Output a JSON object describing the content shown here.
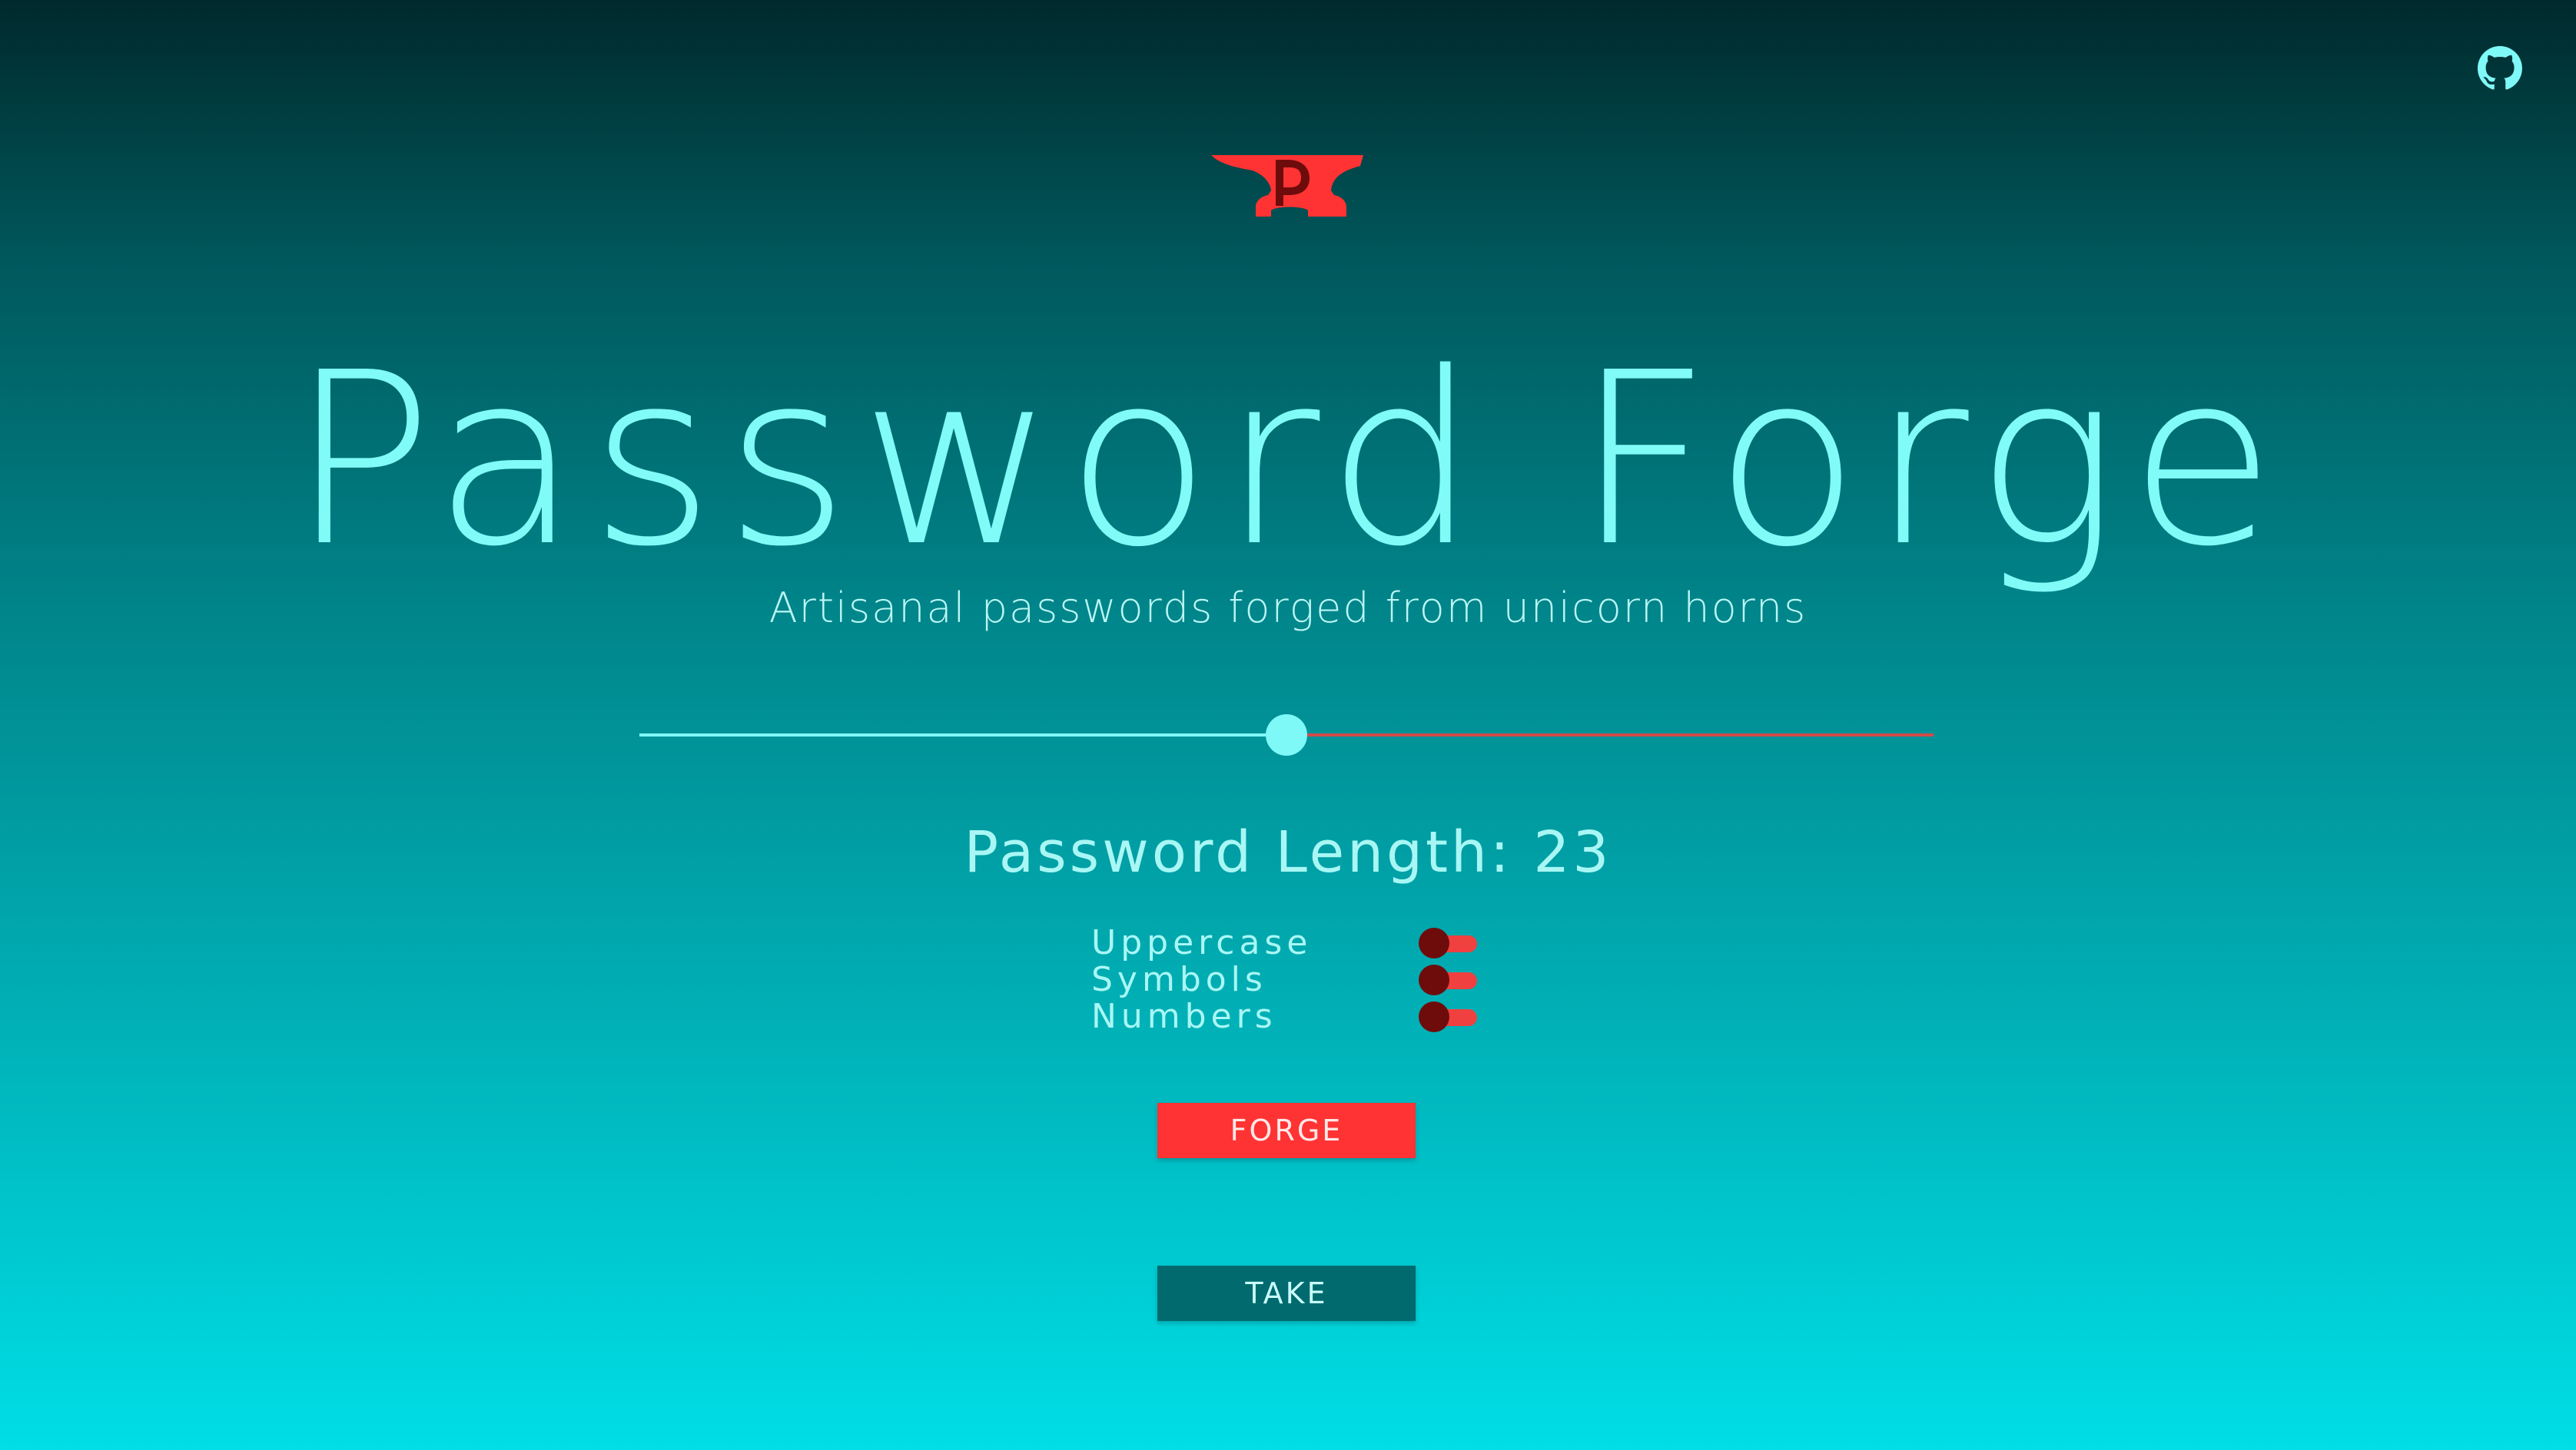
{
  "app": {
    "title": "Password Forge",
    "subtitle": "Artisanal passwords forged from unicorn horns"
  },
  "header": {
    "github_icon": "github-icon",
    "logo_icon": "anvil-logo-icon"
  },
  "length": {
    "label": "Password Length: ",
    "value": "23",
    "slider_fraction": 0.5
  },
  "options": [
    {
      "label": "Uppercase",
      "enabled": false
    },
    {
      "label": "Symbols",
      "enabled": false
    },
    {
      "label": "Numbers",
      "enabled": false
    }
  ],
  "buttons": {
    "forge_label": "FORGE",
    "take_label": "TAKE"
  },
  "colors": {
    "accent": "#7ff8f8",
    "danger": "#ff3333",
    "toggle_knob": "#6e0c0c",
    "take_button": "#006a6e",
    "slider_remaining": "#d34a4a"
  }
}
